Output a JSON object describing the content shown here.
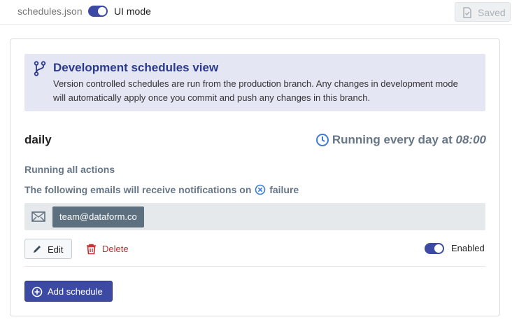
{
  "topbar": {
    "filename": "schedules.json",
    "mode_label": "UI mode",
    "saved_label": "Saved",
    "saved_icon": "document-check-icon"
  },
  "callout": {
    "icon": "git-branch-icon",
    "title": "Development schedules view",
    "description": "Version controlled schedules are run from the production branch. Any changes in development mode will automatically apply once you commit and push any changes in this branch."
  },
  "schedule": {
    "name": "daily",
    "running_prefix": "Running every day at",
    "time": "08:00",
    "actions_text": "Running all actions",
    "emails_prefix": "The following emails will receive notifications on",
    "emails_suffix": "failure",
    "emails": [
      "team@dataform.co"
    ],
    "edit_label": "Edit",
    "delete_label": "Delete",
    "enabled_label": "Enabled",
    "enabled": true
  },
  "add_schedule_label": "Add schedule",
  "colors": {
    "accent": "#3d4aa4",
    "callout_bg": "#e4e6f4",
    "callout_title": "#2b3a8f",
    "muted": "#667687",
    "danger": "#c23030",
    "tag_bg": "#5c7080"
  }
}
